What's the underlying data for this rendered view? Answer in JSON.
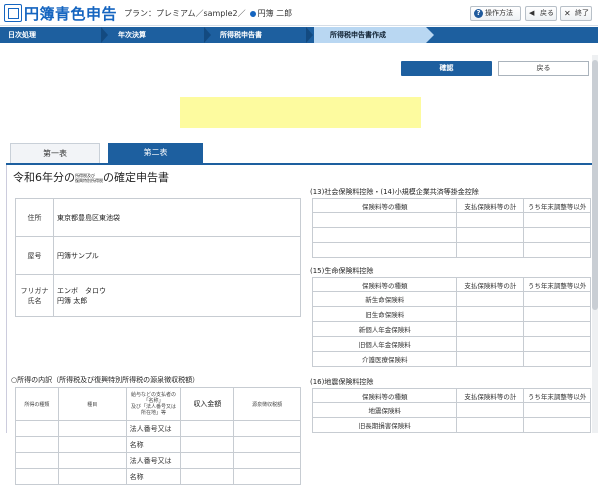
{
  "app": {
    "title": "円簿青色申告",
    "plan": "プラン：プレミアム／sample2／",
    "user": "円簿 二郎"
  },
  "header_buttons": {
    "help": "操作方法",
    "back": "戻る",
    "close": "終了",
    "help_icon": "?",
    "back_icon": "◀",
    "close_icon": "✕"
  },
  "nav": {
    "steps": [
      {
        "label": "日次処理"
      },
      {
        "label": "年次決算"
      },
      {
        "label": "所得税申告書"
      },
      {
        "label": "所得税申告書作成"
      }
    ]
  },
  "actions": {
    "confirm": "確認",
    "back": "戻る"
  },
  "tabs": [
    {
      "label": "第一表"
    },
    {
      "label": "第二表"
    }
  ],
  "form": {
    "title_pre": "令和6年分の",
    "title_small_1": "所得税及び",
    "title_small_2": "復興特別所得税",
    "title_post": "の確定申告書",
    "address_label": "住所",
    "address_value": "東京都豊島区東池袋",
    "shop_label": "屋号",
    "shop_value": "円簿サンプル",
    "name_label_1": "フリガナ",
    "name_label_2": "氏名",
    "kana_value": "エンボ　タロウ",
    "name_value": "円簿 太郎"
  },
  "income_section": {
    "title": "○所得の内訳（所得税及び復興特別所得税の源泉徴収税額）",
    "col_kind": "所得の種類",
    "col_item": "種目",
    "col_payer_1": "給与などの支払者の",
    "col_payer_2": "「名称」",
    "col_payer_3": "及び「法人番号又は",
    "col_payer_4": "所在地」等",
    "col_amount": "収入金額",
    "col_tax": "源泉徴収税額",
    "corp_number": "法人番号又は",
    "name": "名称"
  },
  "insurance_social": {
    "title": "(13)社会保険料控除・(14)小規模企業共済等掛金控除",
    "col_kind": "保険料等の種類",
    "col_paid": "支払保険料等の計",
    "col_adj": "うち年末調整等以外"
  },
  "insurance_life": {
    "title": "(15)生命保険料控除",
    "col_kind": "保険料等の種類",
    "col_paid": "支払保険料等の計",
    "col_adj": "うち年末調整等以外",
    "rows": [
      {
        "label": "新生命保険料"
      },
      {
        "label": "旧生命保険料"
      },
      {
        "label": "新個人年金保険料"
      },
      {
        "label": "旧個人年金保険料"
      },
      {
        "label": "介護医療保険料"
      }
    ]
  },
  "insurance_quake": {
    "title": "(16)地震保険料控除",
    "col_kind": "保険料等の種類",
    "col_paid": "支払保険料等の計",
    "col_adj": "うち年末調整等以外",
    "rows": [
      {
        "label": "地震保険料"
      },
      {
        "label": "旧長期損害保険料"
      }
    ]
  }
}
